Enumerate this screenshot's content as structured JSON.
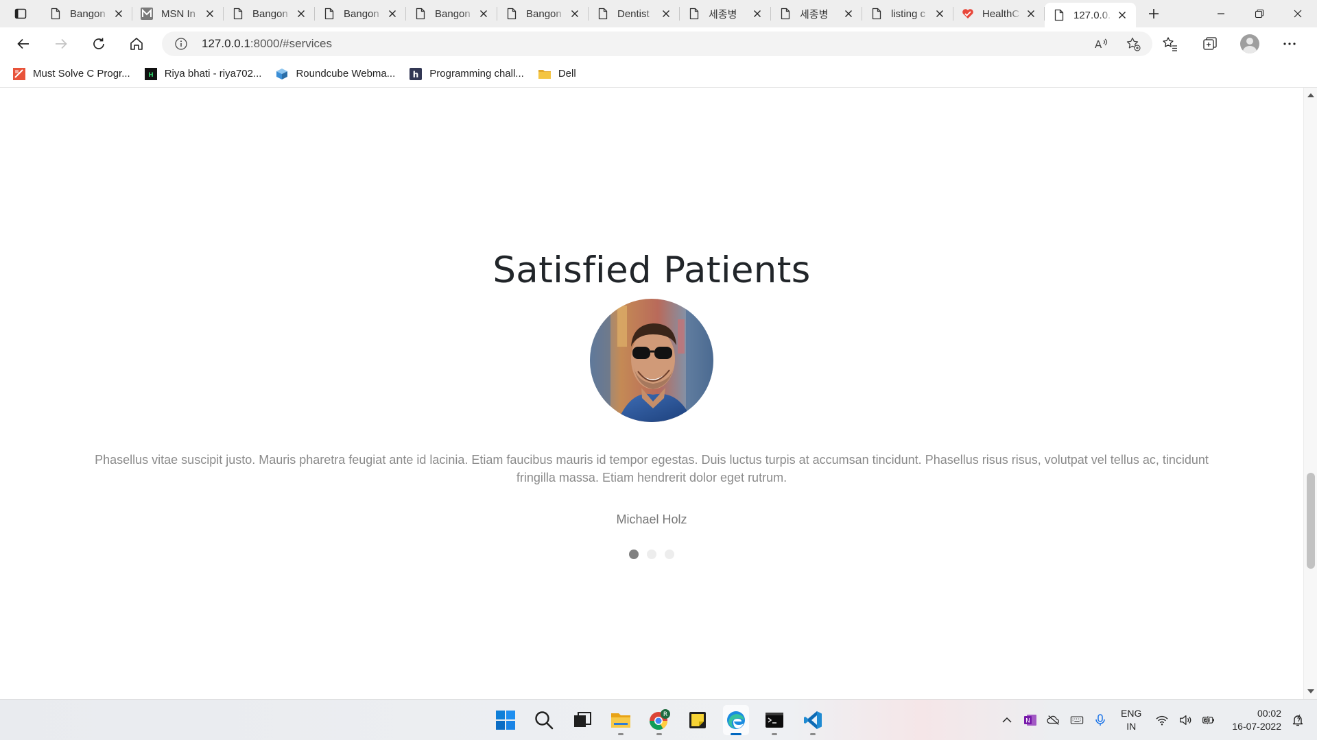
{
  "browser": {
    "tabs": [
      {
        "title": "Bangon",
        "icon": "page-icon"
      },
      {
        "title": "MSN In",
        "icon": "msn-icon"
      },
      {
        "title": "Bangon",
        "icon": "page-icon"
      },
      {
        "title": "Bangon",
        "icon": "page-icon"
      },
      {
        "title": "Bangon",
        "icon": "page-icon"
      },
      {
        "title": "Bangon",
        "icon": "page-icon"
      },
      {
        "title": "Dentist",
        "icon": "page-icon"
      },
      {
        "title": "세종병",
        "icon": "page-icon"
      },
      {
        "title": "세종병",
        "icon": "page-icon"
      },
      {
        "title": "listing c",
        "icon": "page-icon"
      },
      {
        "title": "HealthC",
        "icon": "healthcare-heart-icon"
      },
      {
        "title": "127.0.0.",
        "icon": "page-icon",
        "active": true
      }
    ],
    "address": {
      "host": "127.0.0.1",
      "path": ":8000/#services"
    },
    "bookmarks": [
      {
        "label": "Must Solve C Progr...",
        "icon": "gfg-red-icon",
        "color": "#e8533a"
      },
      {
        "label": "Riya bhati - riya702...",
        "icon": "hackerrank-icon",
        "color": "#111111"
      },
      {
        "label": "Roundcube Webma...",
        "icon": "roundcube-icon",
        "color": "#3a8ed6"
      },
      {
        "label": "Programming chall...",
        "icon": "hackerearth-icon",
        "color": "#323754"
      },
      {
        "label": "Dell",
        "icon": "folder-icon",
        "color": "#f4c542"
      }
    ]
  },
  "page": {
    "section_title": "Satisfied Patients",
    "testimonial": "Phasellus vitae suscipit justo. Mauris pharetra feugiat ante id lacinia. Etiam faucibus mauris id tempor egestas. Duis luctus turpis at accumsan tincidunt. Phasellus risus risus, volutpat vel tellus ac, tincidunt fringilla massa. Etiam hendrerit dolor eget rutrum.",
    "patient_name": "Michael Holz",
    "carousel": {
      "count": 3,
      "active_index": 0
    }
  },
  "taskbar": {
    "apps": [
      "windows-start-icon",
      "search-icon",
      "task-view-icon",
      "file-explorer-icon",
      "chrome-icon",
      "sticky-notes-icon",
      "edge-icon",
      "terminal-icon",
      "vscode-icon"
    ],
    "active_app": "edge-icon",
    "chrome_badge": "R",
    "language_top": "ENG",
    "language_bottom": "IN",
    "time": "00:02",
    "date": "16-07-2022"
  },
  "colors": {
    "accent": "#0067c0",
    "title_text": "#212529",
    "body_text": "#8a8a8a",
    "dot_active": "#808080",
    "dot_inactive": "#ededed"
  }
}
